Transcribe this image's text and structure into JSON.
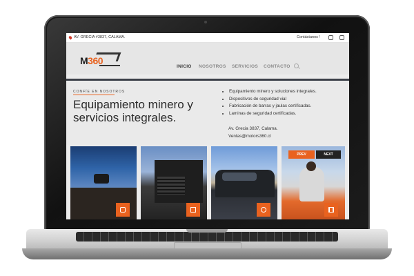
{
  "topbar": {
    "address": "AV. GRECIA #3837, CALAMA.",
    "contact_link": "Contáctanos !"
  },
  "header": {
    "logo_text_m": "M",
    "logo_text_num": "360",
    "nav": [
      {
        "label": "INICIO",
        "active": true
      },
      {
        "label": "NOSOTROS",
        "active": false
      },
      {
        "label": "SERVICIOS",
        "active": false
      },
      {
        "label": "CONTACTO",
        "active": false
      }
    ]
  },
  "hero": {
    "eyebrow": "CONFÍE EN NOSOTROS",
    "headline": "Equipamiento minero y servicios integrales.",
    "bullets": [
      "Equipamiento minero y soluciones integrales.",
      "Dispositivos de seguridad vial",
      "Fabricación de barras y jaulas certificadas.",
      "Laminas de seguridad certificadas."
    ],
    "address": "Av. Grecia 3837, Calama.",
    "email": "Ventas@motors360.cl"
  },
  "slider": {
    "prev_label": "PREV",
    "next_label": "NEXT"
  },
  "tiles": [
    {
      "icon": "camera-icon"
    },
    {
      "icon": "frame-icon"
    },
    {
      "icon": "clock-icon"
    },
    {
      "icon": "columns-icon"
    }
  ],
  "colors": {
    "accent": "#e9621f",
    "dark": "#3b3f48",
    "header_bg": "#e6e6e6"
  }
}
